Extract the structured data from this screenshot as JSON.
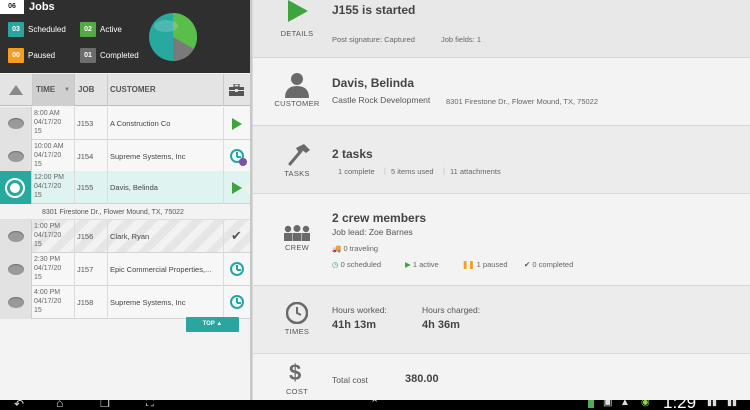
{
  "summary": {
    "jobs_count": "06",
    "jobs_label": "Jobs",
    "stats": [
      {
        "count": "03",
        "label": "Scheduled",
        "color": "#2aa59f"
      },
      {
        "count": "02",
        "label": "Active",
        "color": "#55a944"
      },
      {
        "count": "00",
        "label": "Paused",
        "color": "#f59d1d"
      },
      {
        "count": "01",
        "label": "Completed",
        "color": "#6d6d6d"
      }
    ]
  },
  "table": {
    "headers": {
      "time": "TIME",
      "job": "JOB",
      "customer": "CUSTOMER"
    },
    "rows": [
      {
        "time": "8:00 AM\n04/17/20\n15",
        "job": "J153",
        "customer": "A Construction Co",
        "action": "play-icon",
        "selected": false
      },
      {
        "time": "10:00 AM\n04/17/20\n15",
        "job": "J154",
        "customer": "Supreme Systems, Inc",
        "action": "clock-icon",
        "selected": false
      },
      {
        "time": "12:00 PM\n04/17/20\n15",
        "job": "J155",
        "customer": "Davis, Belinda",
        "action": "play-icon",
        "selected": true
      },
      {
        "time": "1:00 PM\n04/17/20\n15",
        "job": "J156",
        "customer": "Clark, Ryan",
        "action": "check-icon",
        "selected": false
      },
      {
        "time": "2:30 PM\n04/17/20\n15",
        "job": "J157",
        "customer": "Epic Commercial Properties,...",
        "action": "clock-icon",
        "selected": false
      },
      {
        "time": "4:00 PM\n04/17/20\n15",
        "job": "J158",
        "customer": "Supreme Systems, Inc",
        "action": "clock-icon",
        "selected": false
      }
    ],
    "selected_address": "8301 Firestone Dr., Flower Mound, TX, 75022"
  },
  "top_button_label": "TOP",
  "details": {
    "label": "DETAILS",
    "title": "J155 is started",
    "post_signature": "Post signature:  Captured",
    "job_fields": "Job fields:  1"
  },
  "customer": {
    "label": "CUSTOMER",
    "name": "Davis, Belinda",
    "company": "Castle Rock Development",
    "address": "8301 Firestone Dr., Flower Mound, TX, 75022"
  },
  "tasks": {
    "label": "TASKS",
    "title": "2 tasks",
    "complete": "1 complete",
    "items_used": "5 items used",
    "attachments": "11 attachments"
  },
  "crew": {
    "label": "CREW",
    "title": "2 crew members",
    "job_lead": "Job lead: Zoe Barnes",
    "traveling": "0 traveling",
    "scheduled": "0 scheduled",
    "active": "1 active",
    "paused": "1 paused",
    "completed": "0 completed"
  },
  "times": {
    "label": "TIMES",
    "worked_label": "Hours worked:",
    "worked_value": "41h 13m",
    "charged_label": "Hours charged:",
    "charged_value": "4h 36m"
  },
  "cost": {
    "label": "COST",
    "total_label": "Total cost",
    "total_value": "380.00"
  },
  "system_bar": {
    "clock": "1:29"
  }
}
